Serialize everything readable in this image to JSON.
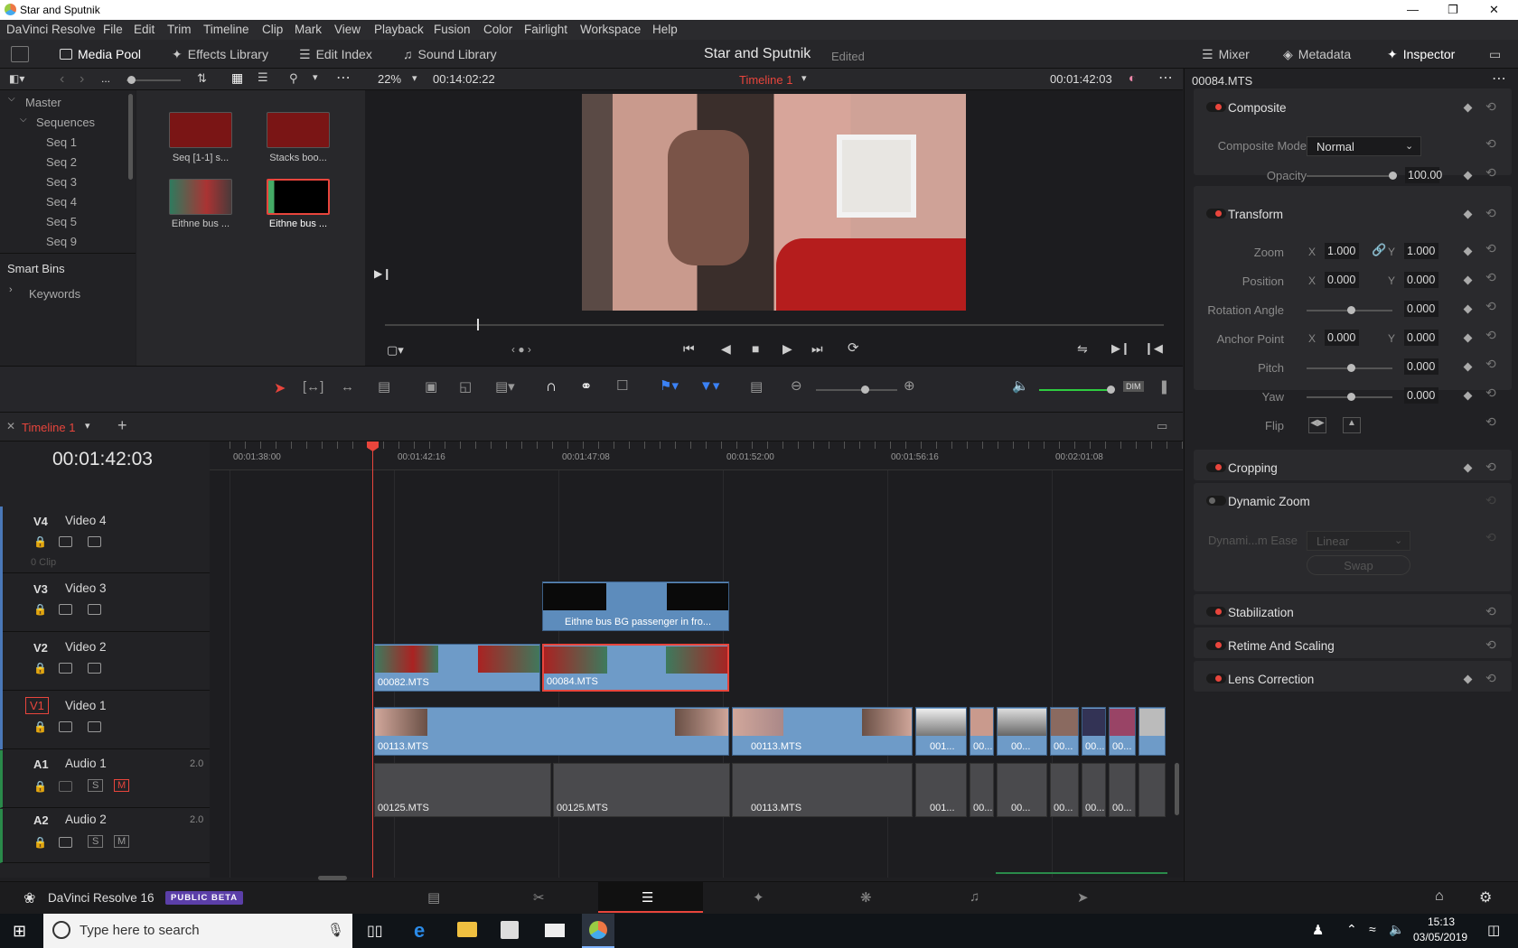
{
  "window": {
    "title": "Star and Sputnik"
  },
  "menu": [
    "DaVinci Resolve",
    "File",
    "Edit",
    "Trim",
    "Timeline",
    "Clip",
    "Mark",
    "View",
    "Playback",
    "Fusion",
    "Color",
    "Fairlight",
    "Workspace",
    "Help"
  ],
  "toolbar": {
    "media_pool": "Media Pool",
    "effects_library": "Effects Library",
    "edit_index": "Edit Index",
    "sound_library": "Sound Library",
    "project_name": "Star and Sputnik",
    "project_status": "Edited",
    "mixer": "Mixer",
    "metadata": "Metadata",
    "inspector": "Inspector"
  },
  "media_pool": {
    "ellipsis": "...",
    "bins": {
      "master": "Master",
      "sequences": "Sequences",
      "items": [
        "Seq 1",
        "Seq 2",
        "Seq 3",
        "Seq 4",
        "Seq 5",
        "Seq 9"
      ],
      "smart_bins": "Smart Bins",
      "keywords": "Keywords"
    },
    "clips": [
      {
        "label": "Seq [1-1] s..."
      },
      {
        "label": "Stacks boo..."
      },
      {
        "label": "Eithne bus ..."
      },
      {
        "label": "Eithne bus ..."
      }
    ]
  },
  "viewer": {
    "zoom": "22%",
    "source_tc": "00:14:02:22",
    "timeline_name": "Timeline 1",
    "record_tc": "00:01:42:03"
  },
  "timeline": {
    "tab": "Timeline 1",
    "timecode": "00:01:42:03",
    "ruler": [
      "00:01:38:00",
      "00:01:42:16",
      "00:01:47:08",
      "00:01:52:00",
      "00:01:56:16",
      "00:02:01:08"
    ],
    "tracks": [
      {
        "id": "V4",
        "name": "Video 4",
        "note": "0 Clip"
      },
      {
        "id": "V3",
        "name": "Video 3"
      },
      {
        "id": "V2",
        "name": "Video 2"
      },
      {
        "id": "V1",
        "name": "Video 1"
      },
      {
        "id": "A1",
        "name": "Audio 1",
        "ch": "2.0",
        "s": "S",
        "m": "M"
      },
      {
        "id": "A2",
        "name": "Audio 2",
        "ch": "2.0",
        "s": "S",
        "m": "M"
      }
    ],
    "clips": {
      "v3": "Eithne bus BG passenger in fro...",
      "v2a": "00082.MTS",
      "v2b": "00084.MTS",
      "v1a": "00113.MTS",
      "v1b": "00113.MTS",
      "v1c": "001...",
      "v1d": "00...",
      "v1e": "00...",
      "v1f": "00...",
      "v1g": "00...",
      "v1h": "00...",
      "a1a": "00125.MTS",
      "a1b": "00125.MTS",
      "a1c": "00113.MTS",
      "a1d": "001...",
      "a1e": "00...",
      "a1f": "00...",
      "a1g": "00...",
      "a1h": "00...",
      "a1i": "00..."
    }
  },
  "inspector": {
    "clip_name": "00084.MTS",
    "composite": {
      "title": "Composite",
      "mode_label": "Composite Mode",
      "mode": "Normal",
      "opacity_label": "Opacity",
      "opacity": "100.00"
    },
    "transform": {
      "title": "Transform",
      "zoom_label": "Zoom",
      "zoom_x": "1.000",
      "zoom_y": "1.000",
      "position_label": "Position",
      "pos_x": "0.000",
      "pos_y": "0.000",
      "rotation_label": "Rotation Angle",
      "rotation": "0.000",
      "anchor_label": "Anchor Point",
      "anchor_x": "0.000",
      "anchor_y": "0.000",
      "pitch_label": "Pitch",
      "pitch": "0.000",
      "yaw_label": "Yaw",
      "yaw": "0.000",
      "flip_label": "Flip",
      "x": "X",
      "y": "Y"
    },
    "cropping": "Cropping",
    "dynamic_zoom": {
      "title": "Dynamic Zoom",
      "ease_label": "Dynami...m Ease",
      "ease": "Linear",
      "swap": "Swap"
    },
    "stabilization": "Stabilization",
    "retime": "Retime And Scaling",
    "lens": "Lens Correction"
  },
  "pagebar": {
    "app": "DaVinci Resolve 16",
    "badge": "PUBLIC BETA"
  },
  "taskbar": {
    "search_placeholder": "Type here to search",
    "time": "15:13",
    "date": "03/05/2019"
  },
  "colors": {
    "accent_red": "#e8453c",
    "clip_blue": "#6e9bc8",
    "badge_purple": "#5b3fa8",
    "playhead": "#e8453c"
  }
}
